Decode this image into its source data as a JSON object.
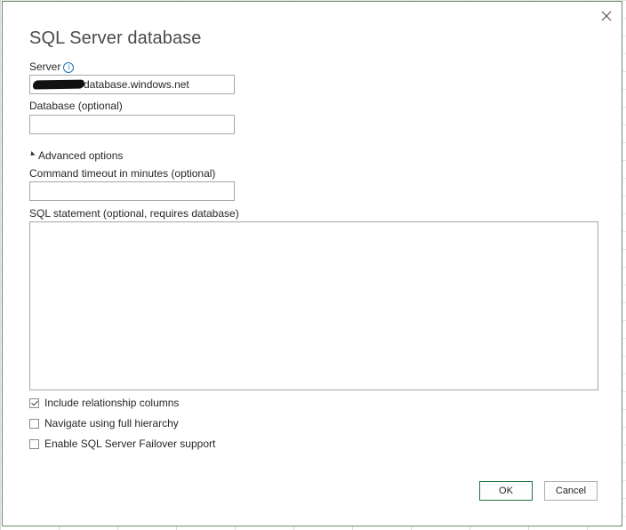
{
  "dialog": {
    "title": "SQL Server database",
    "close_icon": "close-icon"
  },
  "server": {
    "label": "Server",
    "info_icon": "info-icon",
    "info_glyph": "i",
    "value_visible": "database.windows.net"
  },
  "database": {
    "label": "Database (optional)",
    "value": ""
  },
  "advanced": {
    "label": "Advanced options",
    "expanded": true
  },
  "timeout": {
    "label": "Command timeout in minutes (optional)",
    "value": ""
  },
  "sql": {
    "label": "SQL statement (optional, requires database)",
    "value": ""
  },
  "options": [
    {
      "label": "Include relationship columns",
      "checked": true
    },
    {
      "label": "Navigate using full hierarchy",
      "checked": false
    },
    {
      "label": "Enable SQL Server Failover support",
      "checked": false
    }
  ],
  "buttons": {
    "ok": "OK",
    "cancel": "Cancel"
  },
  "colors": {
    "ok_border": "#217346",
    "title": "#4a4a4a",
    "info_icon": "#1f6fbf"
  }
}
